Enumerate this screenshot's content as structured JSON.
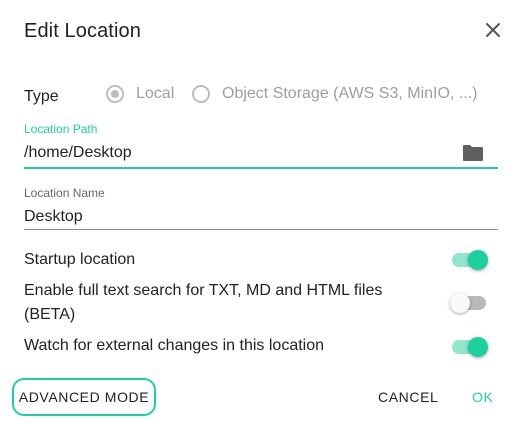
{
  "dialog": {
    "title": "Edit Location",
    "close_icon": "close-icon"
  },
  "type": {
    "label": "Type",
    "options": [
      {
        "label": "Local",
        "selected": true
      },
      {
        "label": "Object Storage (AWS S3, MinIO, ...)",
        "selected": false
      }
    ]
  },
  "location_path": {
    "label": "Location Path",
    "value": "/home/Desktop",
    "icon": "folder-icon"
  },
  "location_name": {
    "label": "Location Name",
    "value": "Desktop"
  },
  "toggles": {
    "startup": {
      "label": "Startup location",
      "enabled": true
    },
    "full_text_search": {
      "label": "Enable full text search for TXT, MD and HTML files (BETA)",
      "enabled": false
    },
    "watch_changes": {
      "label": "Watch for external changes in this location",
      "enabled": true
    }
  },
  "actions": {
    "advanced_mode": "ADVANCED MODE",
    "cancel": "CANCEL",
    "ok": "OK"
  },
  "colors": {
    "accent": "#1dd19f",
    "disabled": "#9e9e9e"
  }
}
